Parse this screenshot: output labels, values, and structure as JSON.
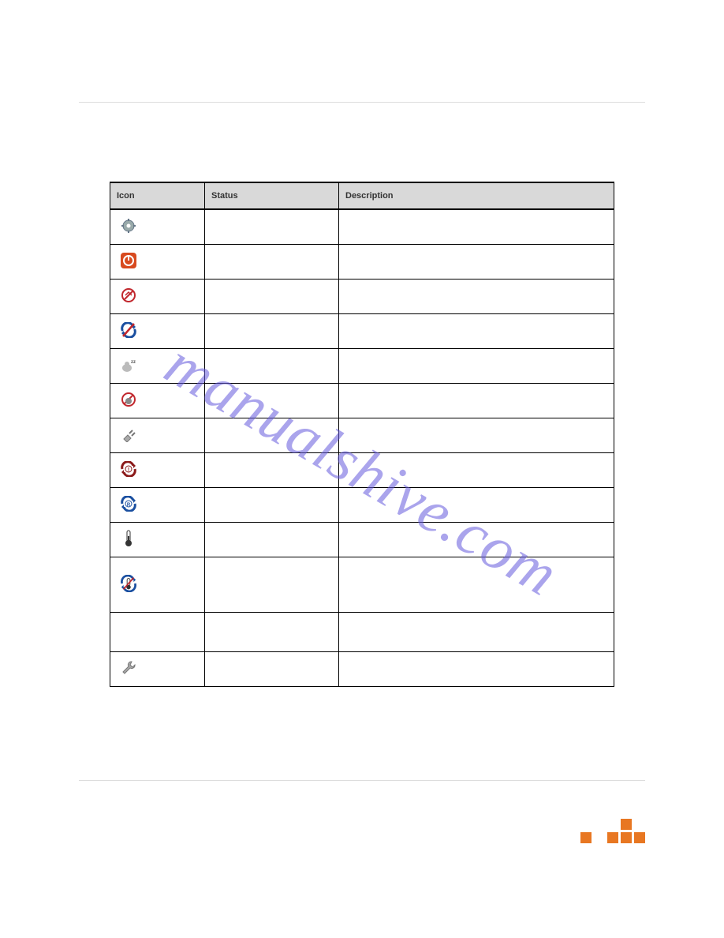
{
  "table": {
    "headers": [
      "Icon",
      "Status",
      "Description"
    ],
    "rows": [
      {
        "icon": "gear-gray",
        "status": "",
        "description": ""
      },
      {
        "icon": "power-red",
        "status": "",
        "description": ""
      },
      {
        "icon": "no-connect-red",
        "status": "",
        "description": ""
      },
      {
        "icon": "sync-blue-slash",
        "status": "",
        "description": ""
      },
      {
        "icon": "sleep-zz",
        "status": "",
        "description": ""
      },
      {
        "icon": "no-gauge-red",
        "status": "",
        "description": ""
      },
      {
        "icon": "plug-gray",
        "status": "",
        "description": ""
      },
      {
        "icon": "refresh-alert-red",
        "status": "",
        "description": ""
      },
      {
        "icon": "refresh-r-blue",
        "status": "",
        "description": ""
      },
      {
        "icon": "thermometer",
        "status": "",
        "description": ""
      },
      {
        "icon": "sync-thermo-blue",
        "status": "",
        "description": ""
      },
      {
        "icon": "spacer",
        "status": "",
        "description": ""
      },
      {
        "icon": "wrench",
        "status": "",
        "description": ""
      }
    ]
  },
  "watermark": "manualshive.com"
}
